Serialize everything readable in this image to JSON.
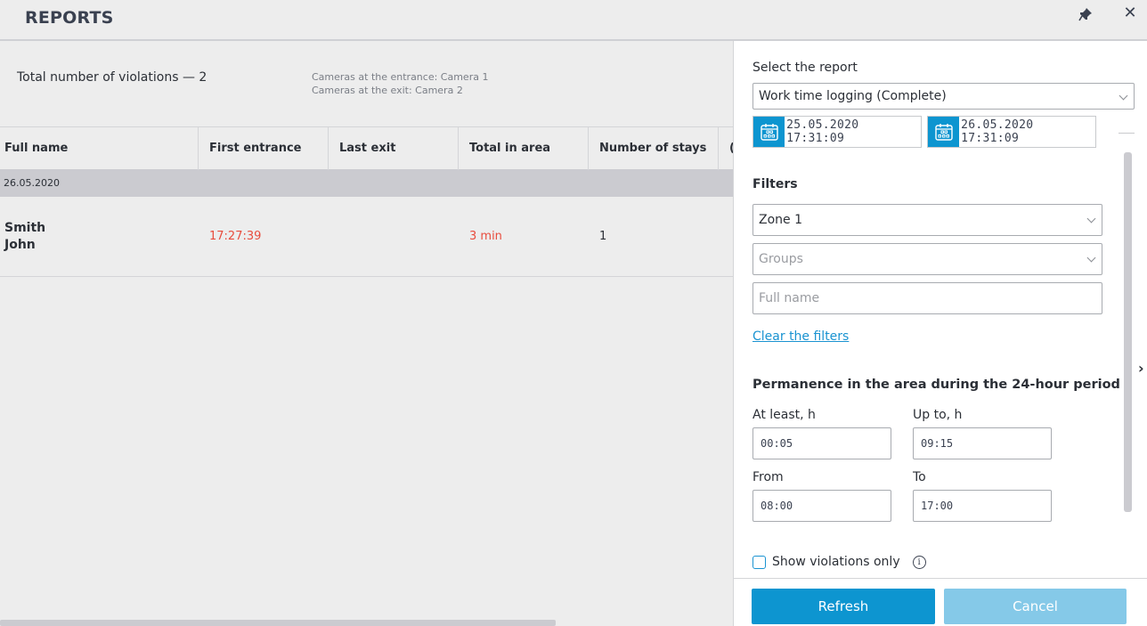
{
  "window": {
    "title": "REPORTS",
    "pin_icon": "pin-icon",
    "close_icon": "close-icon",
    "close_glyph": "✕"
  },
  "report": {
    "summary": "Total number of violations — 2",
    "cameras_entrance": "Cameras at the entrance: Camera 1",
    "cameras_exit": "Cameras at the exit: Camera 2",
    "columns": [
      "Full name",
      "First entrance",
      "Last exit",
      "Total in area",
      "Number of stays",
      "("
    ],
    "groups": [
      {
        "date": "26.05.2020",
        "rows": [
          {
            "last_name": "Smith",
            "first_name": "John",
            "first_entrance": "17:27:39",
            "last_exit": "",
            "total_in_area": "3 min",
            "number_of_stays": "1"
          }
        ]
      }
    ]
  },
  "panel": {
    "select_report_label": "Select the report",
    "selected_report": "Work time logging (Complete)",
    "date_from": "25.05.2020  17:31:09",
    "date_to": "26.05.2020  17:31:09",
    "filters_title": "Filters",
    "zone_value": "Zone 1",
    "groups_placeholder": "Groups",
    "fullname_placeholder": "Full name",
    "clear_filters": "Clear the filters",
    "permanence_title": "Permanence in the area during the 24-hour period",
    "at_least_label": "At least, h",
    "at_least_value": "00:05",
    "up_to_label": "Up to, h",
    "up_to_value": "09:15",
    "from_label": "From",
    "from_value": "08:00",
    "to_label": "To",
    "to_value": "17:00",
    "show_violations_only": "Show violations only",
    "show_violations_checked": false,
    "info_glyph": "i",
    "expand_glyph": "›",
    "refresh_label": "Refresh",
    "cancel_label": "Cancel"
  },
  "colors": {
    "accent": "#0d95d0",
    "accent_disabled": "#85c9e8",
    "violation": "#e84c3d",
    "group_row": "#cbcbd0",
    "link": "#1a93d1"
  }
}
